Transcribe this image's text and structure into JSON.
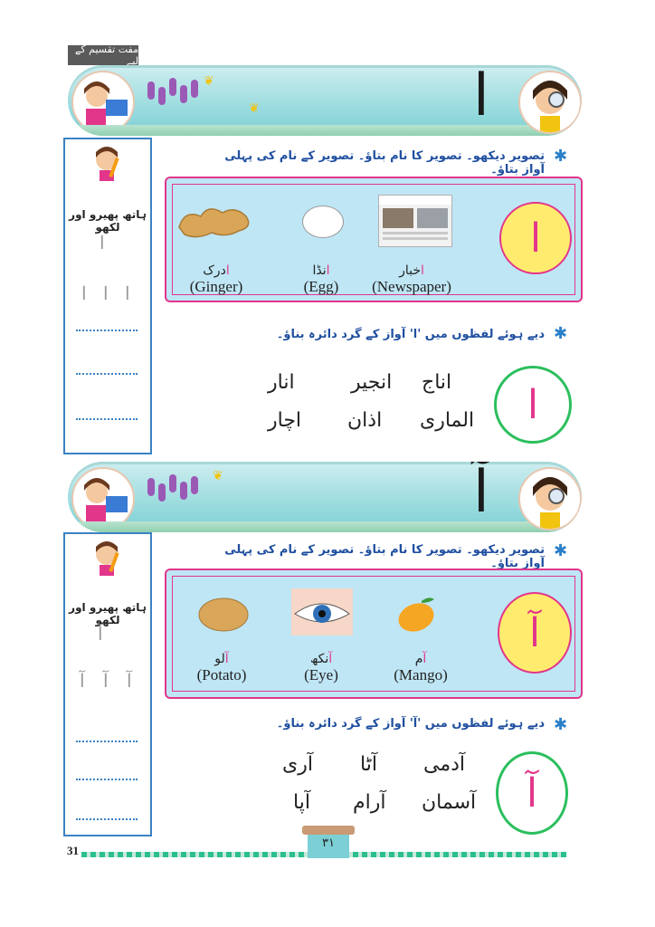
{
  "header_tag": "مفت تقسیم کے لیے",
  "section1": {
    "banner_letter": "ا",
    "instruction1": "تصویر دیکھو۔ تصویر کا نام بتاؤ۔ تصویر کے نام کی پہلی آواز بتاؤ۔",
    "side_title": "ہاتھ پھیرو اور لکھو",
    "trace_big": "ا",
    "trace_row": [
      "ا",
      "ا",
      "ا"
    ],
    "panel_letter": "ا",
    "items": [
      {
        "urdu_first": "ا",
        "urdu_rest": "خبار",
        "english": "(Newspaper)",
        "image": "newspaper-image"
      },
      {
        "urdu_first": "ا",
        "urdu_rest": "نڈا",
        "english": "(Egg)",
        "image": "egg-image"
      },
      {
        "urdu_first": "ا",
        "urdu_rest": "درک",
        "english": "(Ginger)",
        "image": "ginger-image"
      }
    ],
    "instruction2": "دیے ہوئے لفظوں میں 'ا' آواز کے گرد دائرہ بناؤ۔",
    "ring_letter": "ا",
    "words_row1": [
      "اناج",
      "انجیر",
      "انار"
    ],
    "words_row2": [
      "الماری",
      "اذان",
      "اچار"
    ]
  },
  "section2": {
    "banner_letter": "آ",
    "instruction1": "تصویر دیکھو۔ تصویر کا نام بتاؤ۔ تصویر کے نام کی پہلی آواز بتاؤ۔",
    "side_title": "ہاتھ پھیرو اور لکھو",
    "trace_big": "آ",
    "trace_row": [
      "آ",
      "آ",
      "آ"
    ],
    "panel_letter": "آ",
    "items": [
      {
        "urdu_first": "آ",
        "urdu_rest": "م",
        "english": "(Mango)",
        "image": "mango-image"
      },
      {
        "urdu_first": "آ",
        "urdu_rest": "نکھ",
        "english": "(Eye)",
        "image": "eye-image"
      },
      {
        "urdu_first": "آ",
        "urdu_rest": "لو",
        "english": "(Potato)",
        "image": "potato-image"
      }
    ],
    "instruction2": "دیے ہوئے لفظوں میں 'آ' آواز کے گرد دائرہ بناؤ۔",
    "ring_letter": "آ",
    "words_row1": [
      "آدمی",
      "آٹا",
      "آری"
    ],
    "words_row2": [
      "آسمان",
      "آرام",
      "آپا"
    ]
  },
  "footer": {
    "page_number": "31",
    "page_number_urdu": "۳۱"
  },
  "colors": {
    "accent_pink": "#e2368b",
    "panel_blue": "#bfe6f5",
    "instruction_blue": "#1f4fa0",
    "ring_green": "#2bbf5e",
    "banner_teal": "#9fdde0"
  }
}
